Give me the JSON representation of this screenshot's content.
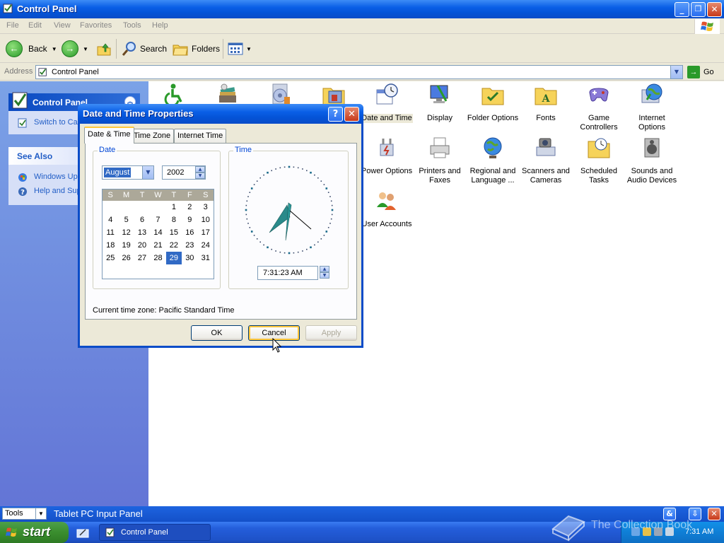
{
  "window": {
    "title": "Control Panel",
    "buttons": {
      "minimize": "_",
      "maximize": "❐",
      "close": "✕"
    }
  },
  "menu": [
    "File",
    "Edit",
    "View",
    "Favorites",
    "Tools",
    "Help"
  ],
  "toolbar": {
    "back": "Back",
    "search": "Search",
    "folders": "Folders"
  },
  "address": {
    "label": "Address",
    "value": "Control Panel",
    "go": "Go"
  },
  "leftpane": {
    "cp_title": "Control Panel",
    "switch_label": "Switch to Ca",
    "see_also_title": "See Also",
    "see_also_items": [
      "Windows Upd",
      "Help and Sup"
    ]
  },
  "content_icons": [
    {
      "label": "",
      "icon": "accessibility-icon"
    },
    {
      "label": "",
      "icon": "add-remove-programs-icon"
    },
    {
      "label": "",
      "icon": "sounds-speech-icon"
    },
    {
      "label": "",
      "icon": "administrative-tools-icon"
    },
    {
      "label": "Date and Time",
      "icon": "date-time-icon"
    },
    {
      "label": "Display",
      "icon": "display-icon"
    },
    {
      "label": "Folder Options",
      "icon": "folder-options-icon"
    },
    {
      "label": "Fonts",
      "icon": "fonts-icon"
    },
    {
      "label": "Game Controllers",
      "icon": "game-controllers-icon"
    },
    {
      "label": "Internet Options",
      "icon": "internet-options-icon"
    },
    {
      "label": "Power Options",
      "icon": "power-options-icon"
    },
    {
      "label": "Printers and Faxes",
      "icon": "printers-icon"
    },
    {
      "label": "Regional and Language ...",
      "icon": "regional-icon"
    },
    {
      "label": "Scanners and Cameras",
      "icon": "scanners-icon"
    },
    {
      "label": "Scheduled Tasks",
      "icon": "scheduled-tasks-icon"
    },
    {
      "label": "Sounds and Audio Devices",
      "icon": "sounds-icon"
    },
    {
      "label": "User Accounts",
      "icon": "user-accounts-icon"
    }
  ],
  "dialog": {
    "title": "Date and Time Properties",
    "help": "?",
    "close": "✕",
    "tabs": [
      "Date & Time",
      "Time Zone",
      "Internet Time"
    ],
    "date_group": "Date",
    "time_group": "Time",
    "month": "August",
    "year": "2002",
    "weekdays": [
      "S",
      "M",
      "T",
      "W",
      "T",
      "F",
      "S"
    ],
    "calendar_rows": [
      [
        "",
        "",
        "",
        "",
        "1",
        "2",
        "3"
      ],
      [
        "4",
        "5",
        "6",
        "7",
        "8",
        "9",
        "10"
      ],
      [
        "11",
        "12",
        "13",
        "14",
        "15",
        "16",
        "17"
      ],
      [
        "18",
        "19",
        "20",
        "21",
        "22",
        "23",
        "24"
      ],
      [
        "25",
        "26",
        "27",
        "28",
        "29",
        "30",
        "31"
      ]
    ],
    "selected_day": "29",
    "time_value": "7:31:23 AM",
    "timezone_line": "Current time zone:  Pacific Standard Time",
    "ok": "OK",
    "cancel": "Cancel",
    "apply": "Apply"
  },
  "inputpanel": {
    "tools": "Tools",
    "title": "Tablet PC Input Panel"
  },
  "taskbar": {
    "start": "start",
    "task_label": "Control Panel",
    "clock": "7:31 AM"
  },
  "watermark": "The Collection Book",
  "colors": {
    "xp_blue": "#0a5fe6",
    "start_green": "#3a8e2e",
    "selection": "#316ac5"
  }
}
